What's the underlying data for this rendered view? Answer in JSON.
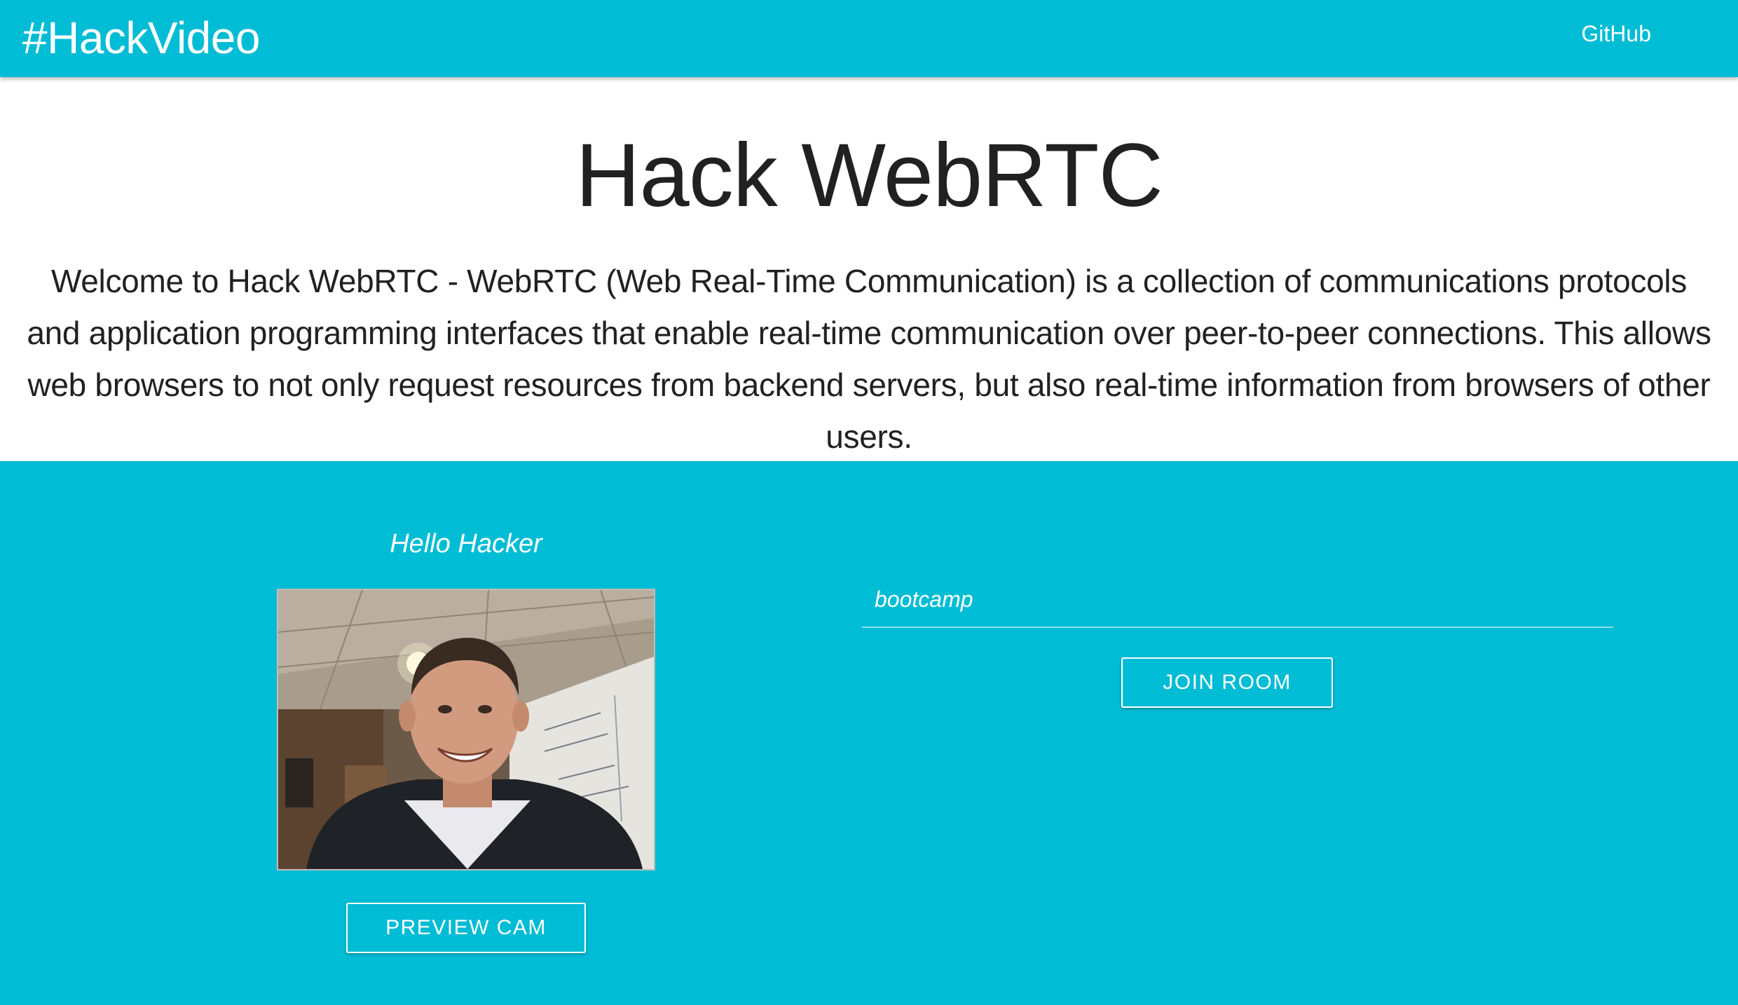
{
  "navbar": {
    "brand": "#HackVideo",
    "github_link": "GitHub"
  },
  "hero": {
    "title": "Hack WebRTC",
    "description": "Welcome to Hack WebRTC - WebRTC (Web Real-Time Communication) is a collection of communications protocols and application programming interfaces that enable real-time communication over peer-to-peer connections. This allows web browsers to not only request resources from backend servers, but also real-time information from browsers of other users."
  },
  "preview": {
    "greeting": "Hello Hacker",
    "button_label": "PREVIEW CAM"
  },
  "room": {
    "input_value": "bootcamp",
    "button_label": "JOIN ROOM"
  },
  "colors": {
    "primary": "#00bcd4",
    "hero_bg": "#ffffff",
    "text_dark": "#212121",
    "text_light": "#ffffff"
  }
}
